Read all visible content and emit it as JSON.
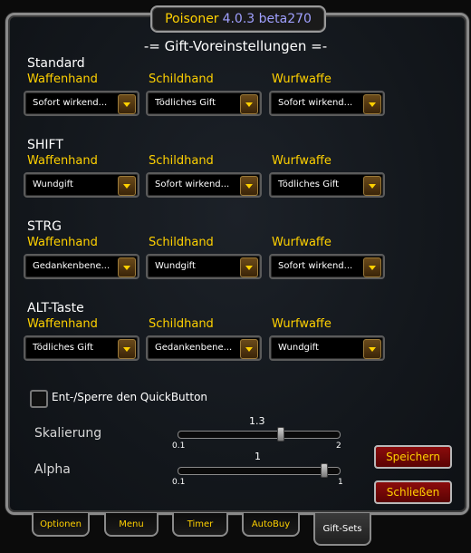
{
  "title": {
    "name": "Poisoner",
    "version": "4.0.3 beta270"
  },
  "heading": "-= Gift-Voreinstellungen =-",
  "column_labels": [
    "Waffenhand",
    "Schildhand",
    "Wurfwaffe"
  ],
  "sections": [
    {
      "label": "Standard",
      "values": [
        "Sofort wirkend...",
        "Tödliches Gift",
        "Sofort wirkend..."
      ]
    },
    {
      "label": "SHIFT",
      "values": [
        "Wundgift",
        "Sofort wirkend...",
        "Tödliches Gift"
      ]
    },
    {
      "label": "STRG",
      "values": [
        "Gedankenbene...",
        "Wundgift",
        "Sofort wirkend..."
      ]
    },
    {
      "label": "ALT-Taste",
      "values": [
        "Tödliches Gift",
        "Gedankenbene...",
        "Wundgift"
      ]
    }
  ],
  "quickbutton": {
    "label": "Ent-/Sperre den QuickButton",
    "checked": false
  },
  "sliders": {
    "scale": {
      "label": "Skalierung",
      "value": "1.3",
      "min": "0.1",
      "max": "2",
      "fraction": 0.63
    },
    "alpha": {
      "label": "Alpha",
      "value": "1",
      "min": "0.1",
      "max": "1",
      "fraction": 0.9
    }
  },
  "buttons": {
    "save": "Speichern",
    "close": "Schließen"
  },
  "tabs": [
    "Optionen",
    "Menu",
    "Timer",
    "AutoBuy",
    "Gift-Sets"
  ],
  "active_tab": "Gift-Sets",
  "icons": {
    "dropdown": "dropdown-arrow-icon"
  },
  "colors": {
    "gold": "#ffd100",
    "version": "#a0a0ff",
    "button_red": "#8b0c0c"
  }
}
